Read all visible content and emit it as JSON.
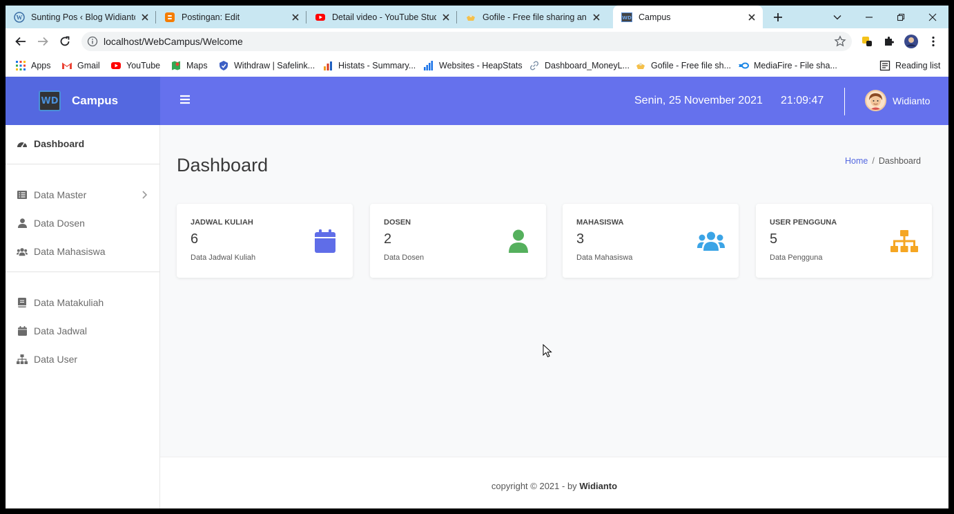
{
  "browser": {
    "tabs": [
      {
        "title": "Sunting Pos ‹ Blog Widianto — WordPress",
        "icon": "wordpress-icon"
      },
      {
        "title": "Postingan: Edit",
        "icon": "blogger-icon"
      },
      {
        "title": "Detail video - YouTube Studio",
        "icon": "youtube-icon"
      },
      {
        "title": "Gofile - Free file sharing and storage",
        "icon": "gofile-icon"
      },
      {
        "title": "Campus",
        "icon": "campus-favicon-icon"
      }
    ],
    "url": "localhost/WebCampus/Welcome",
    "bookmarks": [
      {
        "label": "Apps",
        "icon": "apps-grid-icon"
      },
      {
        "label": "Gmail",
        "icon": "gmail-icon"
      },
      {
        "label": "YouTube",
        "icon": "youtube-icon"
      },
      {
        "label": "Maps",
        "icon": "maps-icon"
      },
      {
        "label": "Withdraw | Safelink...",
        "icon": "safelink-icon"
      },
      {
        "label": "Histats - Summary...",
        "icon": "histats-icon"
      },
      {
        "label": "Websites - HeapStats",
        "icon": "heapstats-icon"
      },
      {
        "label": "Dashboard_MoneyL...",
        "icon": "link-icon"
      },
      {
        "label": "Gofile - Free file sh...",
        "icon": "gofile-icon"
      },
      {
        "label": "MediaFire - File sha...",
        "icon": "mediafire-icon"
      },
      {
        "label": "Reading list",
        "icon": "reading-list-icon"
      }
    ]
  },
  "app": {
    "brand": "Campus",
    "logo_text": "WD",
    "date": "Senin, 25 November 2021",
    "time": "21:09:47",
    "user": "Widianto"
  },
  "sidebar": {
    "items": [
      {
        "label": "Dashboard",
        "icon": "dashboard-gauge-icon"
      },
      {
        "label": "Data Master",
        "icon": "list-alt-icon"
      },
      {
        "label": "Data Dosen",
        "icon": "user-icon"
      },
      {
        "label": "Data Mahasiswa",
        "icon": "users-icon"
      },
      {
        "label": "Data Matakuliah",
        "icon": "book-icon"
      },
      {
        "label": "Data Jadwal",
        "icon": "calendar-icon"
      },
      {
        "label": "Data User",
        "icon": "sitemap-icon"
      }
    ]
  },
  "content": {
    "title": "Dashboard",
    "breadcrumb": {
      "home": "Home",
      "sep": "/",
      "current": "Dashboard"
    },
    "cards": [
      {
        "title": "JADWAL KULIAH",
        "value": "6",
        "sub": "Data Jadwal Kuliah",
        "icon": "calendar-icon",
        "color": "#5f6de8"
      },
      {
        "title": "DOSEN",
        "value": "2",
        "sub": "Data Dosen",
        "icon": "user-icon",
        "color": "#55b05d"
      },
      {
        "title": "MAHASISWA",
        "value": "3",
        "sub": "Data Mahasiswa",
        "icon": "users-icon",
        "color": "#3ba4e6"
      },
      {
        "title": "USER PENGGUNA",
        "value": "5",
        "sub": "Data Pengguna",
        "icon": "sitemap-icon",
        "color": "#f5a623"
      }
    ]
  },
  "footer": {
    "prefix": "copyright © 2021 - by",
    "author": "Widianto"
  },
  "colors": {
    "brand": "#5468e0",
    "topbar": "#6571ed"
  }
}
